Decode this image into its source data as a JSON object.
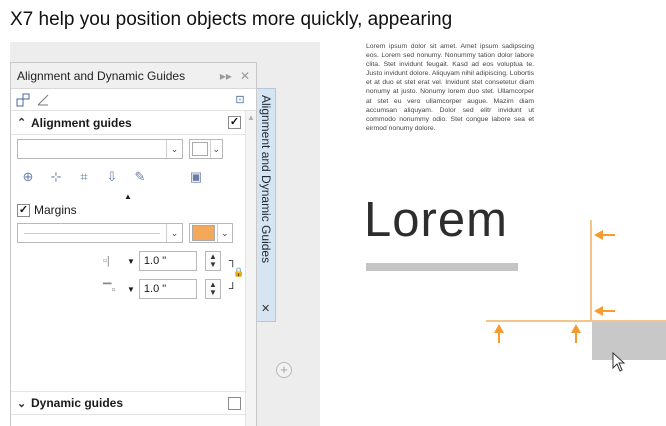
{
  "caption": "X7 help you position objects more quickly, appearing",
  "docker": {
    "title": "Alignment and Dynamic Guides",
    "pin_glyph": "▸▸",
    "close_glyph": "✕",
    "tab_icons": [
      "alignment-tab-icon",
      "dynamic-tab-icon"
    ],
    "page_icon_glyph": "⊡",
    "alignment": {
      "label": "Alignment guides",
      "expanded_glyph": "⌃",
      "checked": "✓",
      "line_style_dropdown_arrow": "⌄",
      "color_dropdown_arrow": "⌄",
      "color": "#ffffff"
    },
    "margins": {
      "label": "Margins",
      "checked": "✓",
      "color": "#f4a85a",
      "horizontal_value": "1.0 \"",
      "vertical_value": "1.0 \"",
      "arrow_glyph": "⌃"
    },
    "dynamic": {
      "label": "Dynamic guides",
      "collapsed_glyph": "⌄"
    }
  },
  "vertical_tab": {
    "label": "Alignment and Dynamic Guides",
    "close_glyph": "✕"
  },
  "document": {
    "paragraph": "Lorem ipsum dolor sit amet. Amet ipsum sadipscing eos. Lorem sed nonumy. Nonummy tation dolor labore clita. Stet invidunt feugait. Kasd ad eos voluptua te. Justo invidunt dolore. Aliquyam nihil adipiscing. Lobortis et at duo et stet erat vel. Invidunt stet consetetur diam nonumy at justo. Nonumy lorem duo stet. Ullamcorper at stet eu vero ullamcorper augue. Mazim diam accumsan aliquyam. Dolor sed elitr invidunt ut commodo nonummy odio. Stet congue labore sea et eirmod nonumy dolore.",
    "heading": "Lorem",
    "guide_color": "#f3c58b",
    "arrow_color": "#f59b2f"
  }
}
